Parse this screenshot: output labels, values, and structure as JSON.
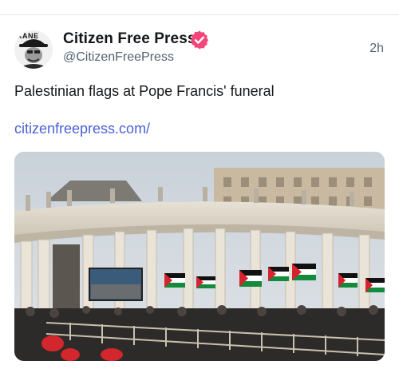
{
  "post": {
    "author_name": "Citizen Free Press",
    "handle": "@CitizenFreePress",
    "time": "2h",
    "text": "Palestinian flags at Pope Francis' funeral",
    "link": "citizenfreepress.com/",
    "avatar_label": "KANE",
    "verified": true
  },
  "colors": {
    "verified_badge": "#f4467a",
    "link": "#4a62d6",
    "text_primary": "#14171a",
    "text_secondary": "#536471"
  },
  "icons": {
    "verified": "verified-badge-icon",
    "avatar": "avatar-image"
  }
}
